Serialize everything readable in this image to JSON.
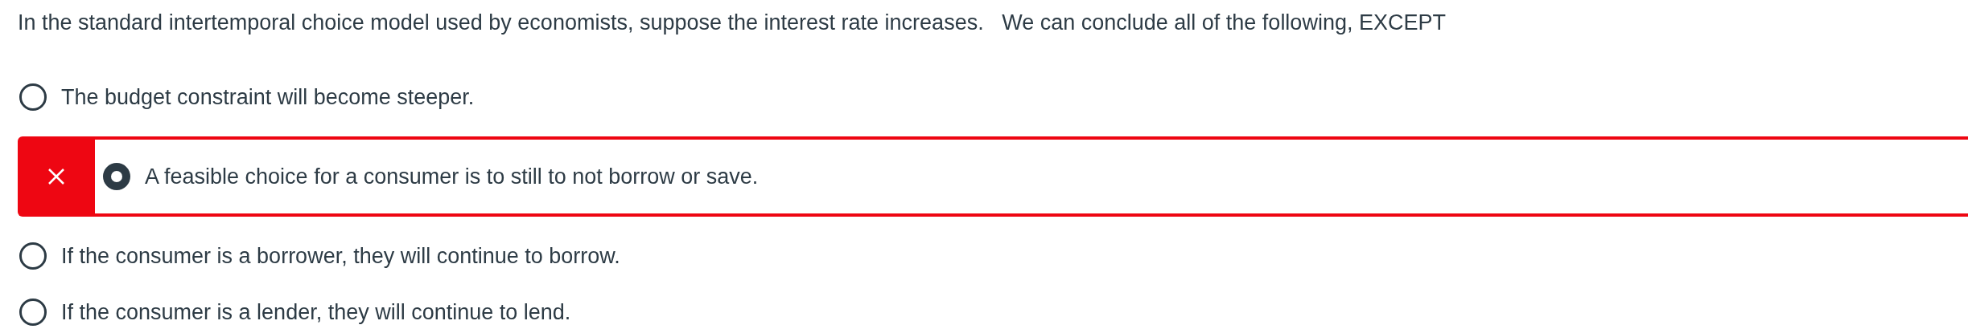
{
  "question": "In the standard intertemporal choice model used by economists, suppose the interest rate increases.   We can conclude all of the following, EXCEPT",
  "answers": [
    {
      "label": "The budget constraint will become steeper.",
      "selected": false,
      "marked_incorrect": false
    },
    {
      "label": "A feasible choice for a consumer is to still to not borrow or save.",
      "selected": true,
      "marked_incorrect": true
    },
    {
      "label": "If the consumer is a borrower, they will continue to borrow.",
      "selected": false,
      "marked_incorrect": false
    },
    {
      "label": "If the consumer is a lender, they will continue to lend.",
      "selected": false,
      "marked_incorrect": false
    }
  ]
}
